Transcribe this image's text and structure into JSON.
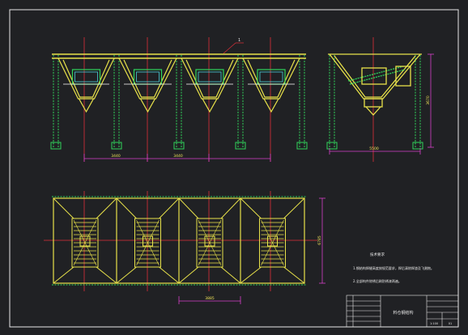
{
  "drawing": {
    "callout_number": "1",
    "front_view": {
      "span_dim_1": "3440",
      "span_dim_2": "3440"
    },
    "side_view": {
      "width_dim": "5500",
      "height_dim": "3670"
    },
    "plan_view": {
      "bay_dim": "3885",
      "depth_dim": "6785"
    },
    "notes": {
      "heading": "技术要求",
      "line_1": "1.钢结构焊缝高度按规范要求，焊后清除焊渣及飞溅物。",
      "line_2": "2.全部构件除锈后刷防锈漆两遍。"
    },
    "title_block": {
      "title": "料仓钢结构",
      "scale": "1:100",
      "sheet": "01"
    }
  }
}
